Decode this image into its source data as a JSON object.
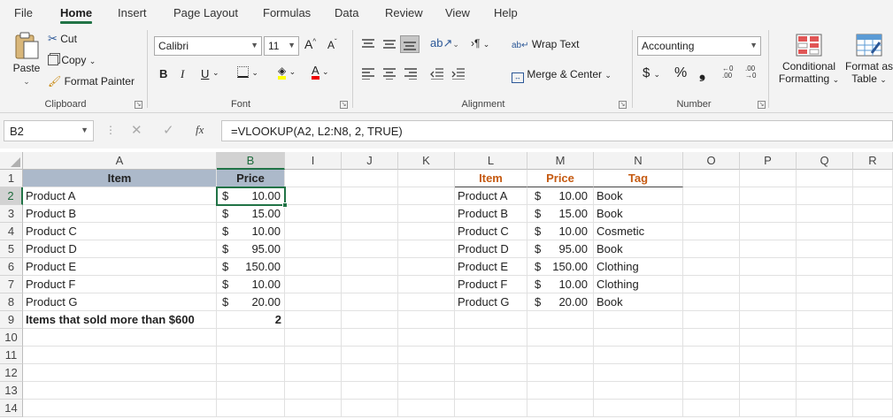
{
  "menu": {
    "tabs": [
      "File",
      "Home",
      "Insert",
      "Page Layout",
      "Formulas",
      "Data",
      "Review",
      "View",
      "Help"
    ],
    "active": "Home"
  },
  "ribbon": {
    "clipboard": {
      "paste": "Paste",
      "cut": "Cut",
      "copy": "Copy",
      "format_painter": "Format Painter",
      "label": "Clipboard"
    },
    "font": {
      "name": "Calibri",
      "size": "11",
      "bold": "B",
      "italic": "I",
      "underline": "U",
      "label": "Font"
    },
    "alignment": {
      "wrap_text": "Wrap Text",
      "merge_center": "Merge & Center",
      "label": "Alignment"
    },
    "number": {
      "format": "Accounting",
      "currency": "$",
      "percent": "%",
      "comma": "❟",
      "label": "Number"
    },
    "styles": {
      "conditional_1": "Conditional",
      "conditional_2": "Formatting",
      "format_as_1": "Format as",
      "format_as_2": "Table"
    }
  },
  "formula_bar": {
    "name_box": "B2",
    "fx": "fx",
    "formula": "=VLOOKUP(A2, L2:N8, 2, TRUE)"
  },
  "columns": [
    "A",
    "B",
    "I",
    "J",
    "K",
    "L",
    "M",
    "N",
    "O",
    "P",
    "Q",
    "R"
  ],
  "rows": [
    "1",
    "2",
    "3",
    "4",
    "5",
    "6",
    "7",
    "8",
    "9",
    "10",
    "11",
    "12",
    "13",
    "14"
  ],
  "left_table": {
    "header_item": "Item",
    "header_price": "Price",
    "rows": [
      {
        "item": "Product A",
        "cur": "$",
        "price": "10.00"
      },
      {
        "item": "Product B",
        "cur": "$",
        "price": "15.00"
      },
      {
        "item": "Product C",
        "cur": "$",
        "price": "10.00"
      },
      {
        "item": "Product D",
        "cur": "$",
        "price": "95.00"
      },
      {
        "item": "Product E",
        "cur": "$",
        "price": "150.00"
      },
      {
        "item": "Product F",
        "cur": "$",
        "price": "10.00"
      },
      {
        "item": "Product G",
        "cur": "$",
        "price": "20.00"
      }
    ],
    "summary_label": "Items that sold more than $600",
    "summary_value": "2"
  },
  "right_table": {
    "header_item": "Item",
    "header_price": "Price",
    "header_tag": "Tag",
    "rows": [
      {
        "item": "Product A",
        "cur": "$",
        "price": "10.00",
        "tag": "Book"
      },
      {
        "item": "Product B",
        "cur": "$",
        "price": "15.00",
        "tag": "Book"
      },
      {
        "item": "Product C",
        "cur": "$",
        "price": "10.00",
        "tag": "Cosmetic"
      },
      {
        "item": "Product D",
        "cur": "$",
        "price": "95.00",
        "tag": "Book"
      },
      {
        "item": "Product E",
        "cur": "$",
        "price": "150.00",
        "tag": "Clothing"
      },
      {
        "item": "Product F",
        "cur": "$",
        "price": "10.00",
        "tag": "Clothing"
      },
      {
        "item": "Product G",
        "cur": "$",
        "price": "20.00",
        "tag": "Book"
      }
    ]
  },
  "colors": {
    "accent": "#217346",
    "header_fill": "#acb9ca",
    "table_header_text": "#c55a11"
  }
}
